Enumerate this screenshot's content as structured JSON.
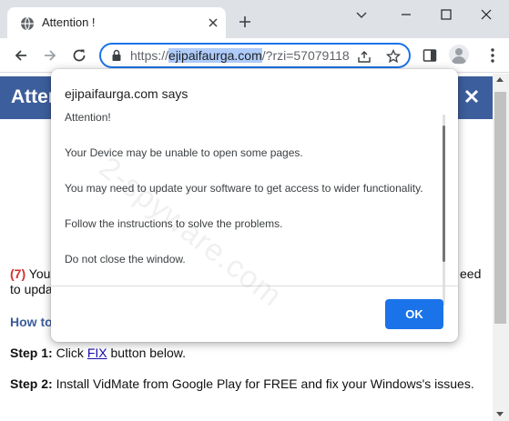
{
  "browser": {
    "tab": {
      "title": "Attention !"
    },
    "url": {
      "scheme": "https://",
      "host": "ejipaifaurga.com",
      "rest": "/?rzi=57079118"
    }
  },
  "page": {
    "banner_title": "Atten",
    "line1_count": "(7)",
    "line1_text": " You",
    "line1_tail": "eed",
    "line2_text": "to upda",
    "howto": "How to",
    "step1_label": "Step 1:",
    "step1_pre": " Click ",
    "step1_link": "FIX",
    "step1_post": " button below.",
    "step2_label": "Step 2:",
    "step2_text": " Install VidMate from Google Play for FREE and fix your Windows's issues."
  },
  "dialog": {
    "title": "ejipaifaurga.com says",
    "messages": [
      "Attention!",
      "Your Device may be unable to open some pages.",
      "You may need to update your software to get access to wider functionality.",
      "Follow the instructions to solve the problems.",
      "Do not close the window."
    ],
    "ok_label": "OK"
  },
  "watermark": "2-spyware.com",
  "colors": {
    "accent": "#1a73e8",
    "banner": "#3d5e9c",
    "count": "#d32f2f"
  },
  "icons": [
    "favicon-globe-icon",
    "close-icon",
    "plus-icon",
    "chevron-down-icon",
    "minimize-icon",
    "maximize-icon",
    "back-icon",
    "forward-icon",
    "reload-icon",
    "lock-icon",
    "share-icon",
    "star-icon",
    "side-panel-icon",
    "profile-icon",
    "menu-icon"
  ]
}
